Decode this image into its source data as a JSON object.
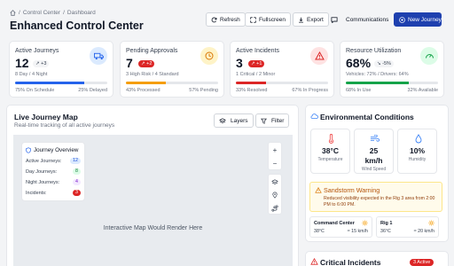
{
  "breadcrumb": {
    "items": [
      "Control Center",
      "Dashboard"
    ],
    "separator": "/"
  },
  "header": {
    "title": "Enhanced Control Center"
  },
  "actions": {
    "refresh": "Refresh",
    "fullscreen": "Fullscreen",
    "export": "Export",
    "communications": "Communications",
    "new_journey": "New Journey"
  },
  "stats": {
    "journeys": {
      "title": "Active Journeys",
      "value": "12",
      "delta": "+3",
      "sub": "8 Day / 4 Night",
      "progress": 0.75,
      "left_label": "75% On Schedule",
      "right_label": "25% Delayed",
      "color": "#2563eb"
    },
    "approvals": {
      "title": "Pending Approvals",
      "value": "7",
      "delta": "+2",
      "sub": "3 High Risk / 4 Standard",
      "progress": 0.43,
      "left_label": "43% Processed",
      "right_label": "57% Pending",
      "color": "#f59e0b"
    },
    "incidents": {
      "title": "Active Incidents",
      "value": "3",
      "delta": "+1",
      "sub": "1 Critical / 2 Minor",
      "progress": 0.33,
      "left_label": "33% Resolved",
      "right_label": "67% In Progress",
      "color": "#dc2626"
    },
    "resources": {
      "title": "Resource Utilization",
      "value": "68%",
      "delta": "-5%",
      "sub": "Vehicles: 72% / Drivers: 64%",
      "progress": 0.68,
      "left_label": "68% In Use",
      "right_label": "32% Available",
      "color": "#16a34a"
    }
  },
  "map": {
    "title": "Live Journey Map",
    "subtitle": "Real-time tracking of all active journeys",
    "layers": "Layers",
    "filter": "Filter",
    "placeholder": "Interactive Map Would Render Here",
    "zoom_in": "+",
    "zoom_out": "−",
    "overview": {
      "title": "Journey Overview",
      "rows": [
        {
          "label": "Active Journeys:",
          "value": "12",
          "bg": "#dbeafe",
          "fg": "#1d4ed8"
        },
        {
          "label": "Day Journeys:",
          "value": "8",
          "bg": "#dcfce7",
          "fg": "#15803d"
        },
        {
          "label": "Night Journeys:",
          "value": "4",
          "bg": "#f3e8ff",
          "fg": "#7e22ce"
        },
        {
          "label": "Incidents:",
          "value": "3",
          "bg": "#dc2626",
          "fg": "#ffffff"
        }
      ]
    }
  },
  "environment": {
    "title": "Environmental Conditions",
    "temperature": {
      "value": "38°C",
      "label": "Temperature"
    },
    "wind": {
      "value": "25",
      "unit": "km/h",
      "label": "Wind Speed"
    },
    "humidity": {
      "value": "10%",
      "label": "Humidity"
    },
    "alert": {
      "title": "Sandstorm Warning",
      "text": "Reduced visibility expected in the Rig 3 area from 2:00 PM to 6:00 PM."
    },
    "locations": [
      {
        "name": "Command Center",
        "temp": "38°C",
        "wind": "15 km/h"
      },
      {
        "name": "Rig 1",
        "temp": "36°C",
        "wind": "20 km/h"
      }
    ]
  },
  "incidents": {
    "title": "Critical Incidents",
    "badge": "3 Active"
  }
}
